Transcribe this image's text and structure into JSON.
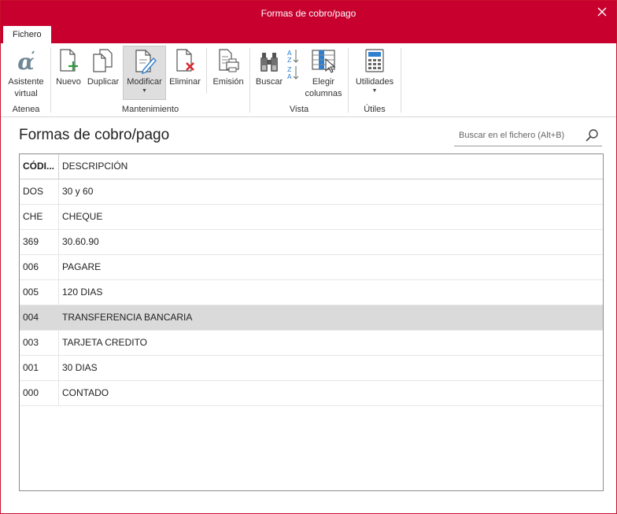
{
  "window": {
    "title": "Formas de cobro/pago"
  },
  "tabs": [
    {
      "label": "Fichero"
    }
  ],
  "ribbon": {
    "groups": [
      {
        "name": "Atenea",
        "buttons": [
          {
            "label_line1": "Asistente",
            "label_line2": "virtual",
            "icon": "alpha-icon"
          }
        ]
      },
      {
        "name": "Mantenimiento",
        "buttons": [
          {
            "label": "Nuevo",
            "icon": "new-document-icon"
          },
          {
            "label": "Duplicar",
            "icon": "duplicate-icon"
          },
          {
            "label": "Modificar",
            "icon": "edit-document-icon",
            "active": true,
            "dropdown": true
          },
          {
            "label": "Eliminar",
            "icon": "delete-document-icon"
          },
          {
            "label": "Emisión",
            "icon": "print-icon"
          }
        ]
      },
      {
        "name": "Vista",
        "buttons": [
          {
            "label": "Buscar",
            "icon": "binoculars-icon"
          },
          {
            "label": "",
            "icon": "sort-icon"
          },
          {
            "label_line1": "Elegir",
            "label_line2": "columnas",
            "icon": "columns-icon"
          }
        ]
      },
      {
        "name": "Útiles",
        "buttons": [
          {
            "label": "Utilidades",
            "icon": "calculator-icon",
            "dropdown": true
          }
        ]
      }
    ]
  },
  "page": {
    "heading": "Formas de cobro/pago"
  },
  "search": {
    "placeholder": "Buscar en el fichero (Alt+B)"
  },
  "table": {
    "columns": [
      "CÓDI...",
      "DESCRIPCIÓN"
    ],
    "rows": [
      {
        "code": "DOS",
        "desc": "30 y 60"
      },
      {
        "code": "CHE",
        "desc": "CHEQUE"
      },
      {
        "code": "369",
        "desc": "30.60.90"
      },
      {
        "code": "006",
        "desc": "PAGARE"
      },
      {
        "code": "005",
        "desc": "120 DIAS"
      },
      {
        "code": "004",
        "desc": "TRANSFERENCIA BANCARIA",
        "selected": true
      },
      {
        "code": "003",
        "desc": "TARJETA CREDITO"
      },
      {
        "code": "001",
        "desc": "30 DIAS"
      },
      {
        "code": "000",
        "desc": "CONTADO"
      }
    ]
  },
  "colors": {
    "titlebar": "#c8002e",
    "selected_row": "#dadada",
    "accent_green": "#2e9b3e",
    "accent_red": "#d9262c",
    "accent_blue": "#2f7fcf"
  }
}
